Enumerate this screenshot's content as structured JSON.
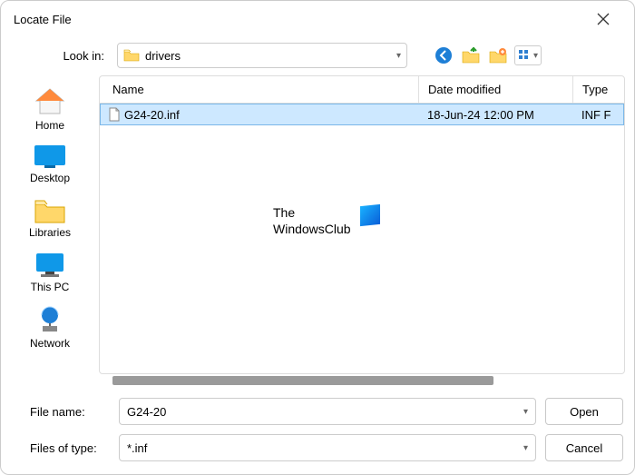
{
  "window": {
    "title": "Locate File"
  },
  "toolbar": {
    "lookin_label": "Look in:",
    "lookin_value": "drivers"
  },
  "columns": {
    "name": "Name",
    "date": "Date modified",
    "type": "Type"
  },
  "files": [
    {
      "name": "G24-20.inf",
      "date": "18-Jun-24 12:00 PM",
      "type": "INF F"
    }
  ],
  "places": {
    "home": "Home",
    "desktop": "Desktop",
    "libraries": "Libraries",
    "thispc": "This PC",
    "network": "Network"
  },
  "bottom": {
    "filename_label": "File name:",
    "filename_value": "G24-20",
    "filetype_label": "Files of type:",
    "filetype_value": "*.inf",
    "open": "Open",
    "cancel": "Cancel"
  },
  "watermark": {
    "line1": "The",
    "line2": "WindowsClub"
  }
}
